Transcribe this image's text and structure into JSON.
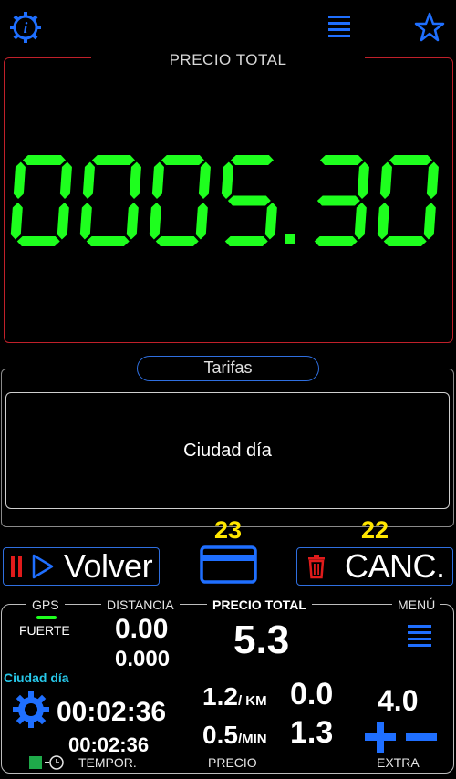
{
  "toolbar": {
    "info_icon": "info-gear-icon",
    "menu_icon": "hamburger-icon",
    "favorite_icon": "star-icon"
  },
  "price_panel": {
    "title": "PRECIO TOTAL",
    "display": "0005.30",
    "display_color": "#1eff1e"
  },
  "tarifas": {
    "label": "Tarifas",
    "selected": "Ciudad día"
  },
  "actions": {
    "volver_label": "Volver",
    "card_count": "23",
    "canc_label": "CANC.",
    "canc_count": "22"
  },
  "bottom": {
    "gps_label": "GPS",
    "gps_signal": "FUERTE",
    "distancia_label": "DISTANCIA",
    "distancia_value": "0.00",
    "distancia_value2": "0.000",
    "precio_total_label": "PRECIO TOTAL",
    "precio_total_value": "5.3",
    "menu_label": "MENÚ",
    "tariff_name": "Ciudad día",
    "timer_main": "00:02:36",
    "timer_secondary": "00:02:36",
    "rate_km": "1.2",
    "rate_km_unit": "/ KM",
    "rate_min": "0.5",
    "rate_min_unit": "/MIN",
    "price_km": "0.0",
    "price_min": "1.3",
    "extra_value": "4.0",
    "tempor_label": "TEMPOR.",
    "precio_label": "PRECIO",
    "extra_label": "EXTRA"
  },
  "colors": {
    "accent_blue": "#1f6fff",
    "yellow": "#ffe600",
    "green": "#1eff1e",
    "cyan": "#27c7e8",
    "red": "#e01b1b"
  }
}
